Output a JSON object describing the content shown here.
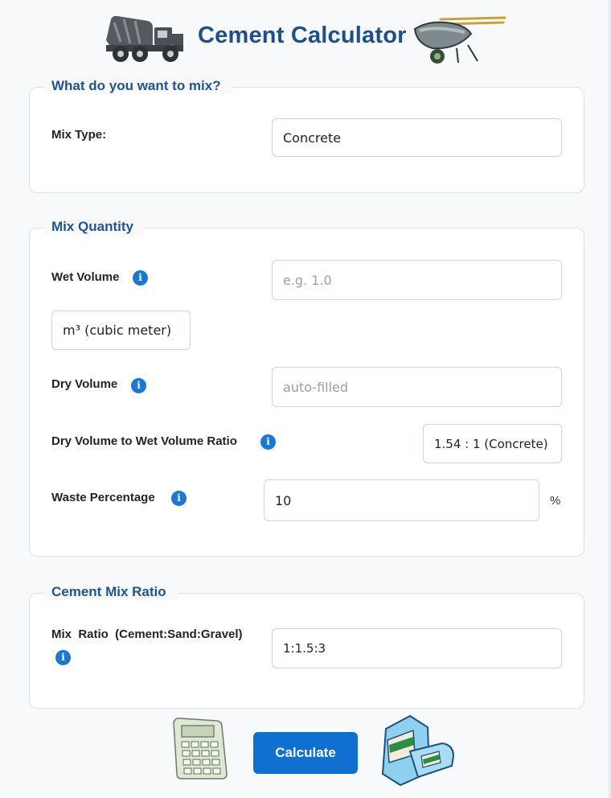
{
  "header": {
    "title": "Cement Calculator"
  },
  "mix_section": {
    "legend": "What do you want to mix?",
    "mix_type_label": "Mix Type:",
    "mix_type_value": "Concrete"
  },
  "quantity_section": {
    "legend": "Mix Quantity",
    "wet_volume_label": "Wet Volume",
    "wet_volume_placeholder": "e.g. 1.0",
    "volume_unit": "m³ (cubic meter)",
    "dry_volume_label": "Dry Volume",
    "dry_volume_placeholder": "auto-filled",
    "ratio_label": "Dry Volume to Wet Volume Ratio",
    "ratio_value": "1.54 : 1 (Concrete)",
    "waste_label": "Waste Percentage",
    "waste_value": "10",
    "waste_unit": "%"
  },
  "ratio_section": {
    "legend": "Cement Mix Ratio",
    "mix_ratio_label": "Mix  Ratio  (Cement:Sand:Gravel)",
    "mix_ratio_value": "1:1.5:3"
  },
  "info_glyph": "i",
  "calculate_label": "Calculate",
  "colors": {
    "title": "#1d4f8c",
    "accent": "#0f70d1",
    "info": "#1a78d4"
  },
  "icons": [
    "cement-truck-icon",
    "wheelbarrow-icon",
    "info-icon",
    "calculator-icon",
    "cement-bag-icon"
  ]
}
